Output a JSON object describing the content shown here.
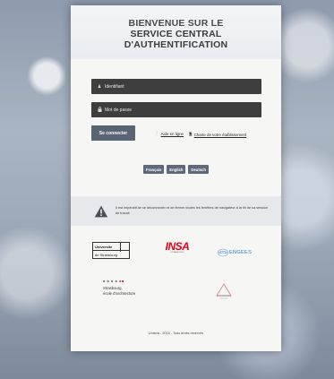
{
  "header": {
    "title_line1": "BIENVENUE SUR LE",
    "title_line2": "SERVICE CENTRAL",
    "title_line3": "D'AUTHENTIFICATION"
  },
  "form": {
    "username_placeholder": "Identifiant",
    "password_placeholder": "Mot de passe",
    "login_button": "Se connecter",
    "help_link": "Aide en ligne",
    "charter_link": "Charte de votre établissement"
  },
  "languages": [
    "Français",
    "English",
    "Deutsch"
  ],
  "warning": {
    "text": "Il est impératif de se déconnecter et de fermer toutes les fenêtres de navigateur à la fin de sa session de travail."
  },
  "logos": {
    "unistra_line1": "Université",
    "unistra_line2": "de Strasbourg",
    "insa": "INSA",
    "insa_sub": "STRASBOURG",
    "engees": "ENGEES",
    "ensas_line1": "Strasbourg,",
    "ensas_line2": "école d'architecture",
    "ensas_mark": "■ ■ ■ ■ ■"
  },
  "footer": {
    "text": "Unistra - 2015 - Tous droits réservés"
  },
  "colors": {
    "field_bg": "#3e3e3e",
    "button_bg": "#596474",
    "insa_red": "#e3001b",
    "engees_blue": "#2a82c9"
  }
}
